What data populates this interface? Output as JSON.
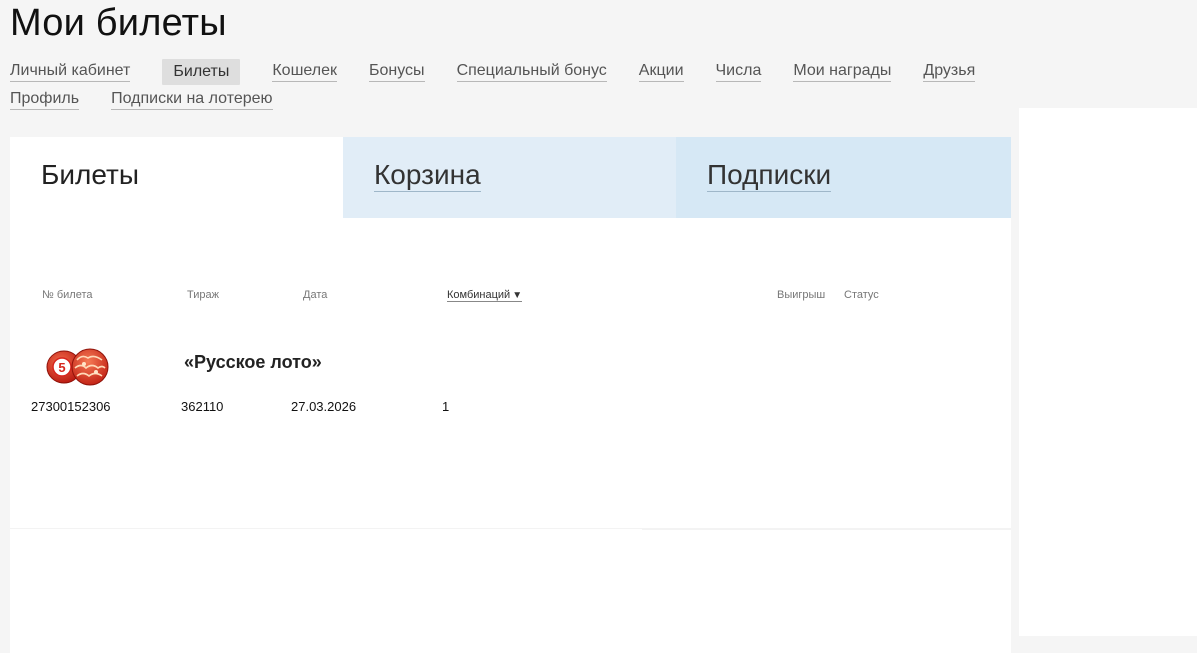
{
  "page": {
    "title": "Мои билеты"
  },
  "nav": {
    "row1": [
      {
        "label": "Личный кабинет",
        "active": false
      },
      {
        "label": "Билеты",
        "active": true
      },
      {
        "label": "Кошелек",
        "active": false
      },
      {
        "label": "Бонусы",
        "active": false
      },
      {
        "label": "Специальный бонус",
        "active": false
      },
      {
        "label": "Акции",
        "active": false
      },
      {
        "label": "Числа",
        "active": false
      },
      {
        "label": "Мои награды",
        "active": false
      },
      {
        "label": "Друзья",
        "active": false
      }
    ],
    "row2": [
      {
        "label": "Профиль",
        "active": false
      },
      {
        "label": "Подписки на лотерею",
        "active": false
      }
    ]
  },
  "tabs": [
    {
      "label": "Билеты",
      "active": true
    },
    {
      "label": "Корзина",
      "active": false
    },
    {
      "label": "Подписки",
      "active": false
    }
  ],
  "table": {
    "headers": {
      "ticket_no": "№ билета",
      "draw": "Тираж",
      "date": "Дата",
      "combinations": "Комбинаций",
      "sort_arrow": "▼",
      "winnings": "Выигрыш",
      "status": "Статус"
    },
    "lottery": {
      "name": "«Русское лото»",
      "logo_icon": "lotto-barrels-icon",
      "logo_number": "5"
    },
    "rows": [
      {
        "ticket_no": "27300152306",
        "draw": "362110",
        "date": "27.03.2026",
        "combinations": "1"
      }
    ]
  },
  "colors": {
    "background": "#f5f5f5",
    "tab_basket": "#e1edf7",
    "tab_subscriptions": "#d6e8f5",
    "active_nav": "#dedede",
    "logo_red": "#d7261e"
  }
}
